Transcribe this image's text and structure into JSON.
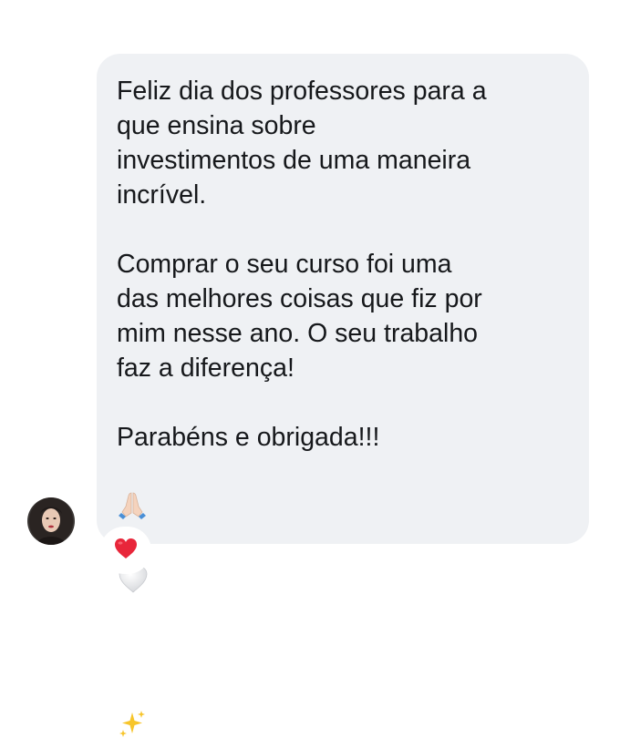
{
  "message": {
    "paragraph_1": "Feliz dia dos professores para a\nque ensina sobre\ninvestimentos de uma maneira\nincrível.",
    "paragraph_2": "Comprar o seu curso foi uma\ndas melhores coisas que fiz por\nmim nesse ano. O seu trabalho\nfaz a diferença!",
    "paragraph_3": "Parabéns e obrigada!!!"
  },
  "emojis": {
    "praying_hands": "praying-hands-icon",
    "white_heart": "white-heart-icon",
    "sparkles": "sparkles-icon"
  },
  "reaction": {
    "icon": "red-heart-icon"
  },
  "colors": {
    "bubble_bg": "#eff1f4",
    "text": "#16181b",
    "reaction_heart": "#e8263a"
  }
}
